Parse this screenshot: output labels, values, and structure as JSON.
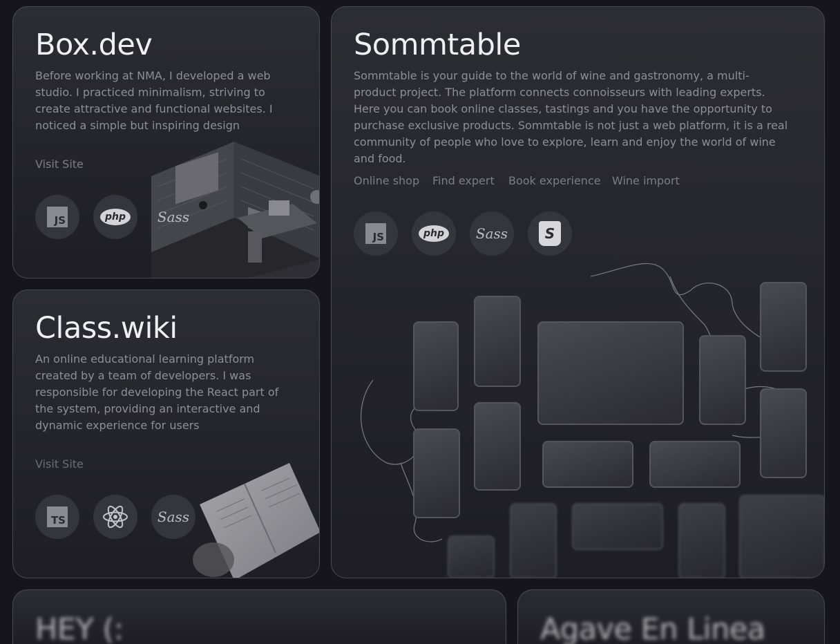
{
  "boxdev": {
    "title": "Box.dev",
    "description": "Before working at NMA, I developed a web studio. I practiced minimalism, striving to create attractive and functional websites. I noticed a simple but inspiring design",
    "visit_label": "Visit Site",
    "tech": [
      {
        "icon": "javascript-icon",
        "label": "JS"
      },
      {
        "icon": "php-icon",
        "label": "php"
      },
      {
        "icon": "sass-icon",
        "label": "Sass"
      }
    ]
  },
  "classwiki": {
    "title": "Class.wiki",
    "description": "An online educational learning platform created by a team of developers. I was responsible for developing the React part of the system, providing an interactive and dynamic experience for users",
    "visit_label": "Visit Site",
    "tech": [
      {
        "icon": "typescript-icon",
        "label": "TS"
      },
      {
        "icon": "react-icon",
        "label": ""
      },
      {
        "icon": "sass-icon",
        "label": "Sass"
      }
    ]
  },
  "sommtable": {
    "title": "Sommtable",
    "description": "Sommtable is your guide to the world of wine and gastronomy, a multi-product project. The platform connects connoisseurs with leading experts. Here you can book online classes, tastings and you have the opportunity to purchase exclusive products. Sommtable is not just a web platform, it is a real community of people who love to explore, learn and enjoy the world of wine and food.",
    "links": [
      "Online shop",
      "Find expert",
      "Book experience",
      "Wine import"
    ],
    "tech": [
      {
        "icon": "javascript-icon",
        "label": "JS"
      },
      {
        "icon": "php-icon",
        "label": "php"
      },
      {
        "icon": "sass-icon",
        "label": "Sass"
      },
      {
        "icon": "shopify-icon",
        "label": "S"
      }
    ]
  },
  "hey": {
    "title": "HEY (:"
  },
  "agave": {
    "title": "Agave En Linea"
  }
}
